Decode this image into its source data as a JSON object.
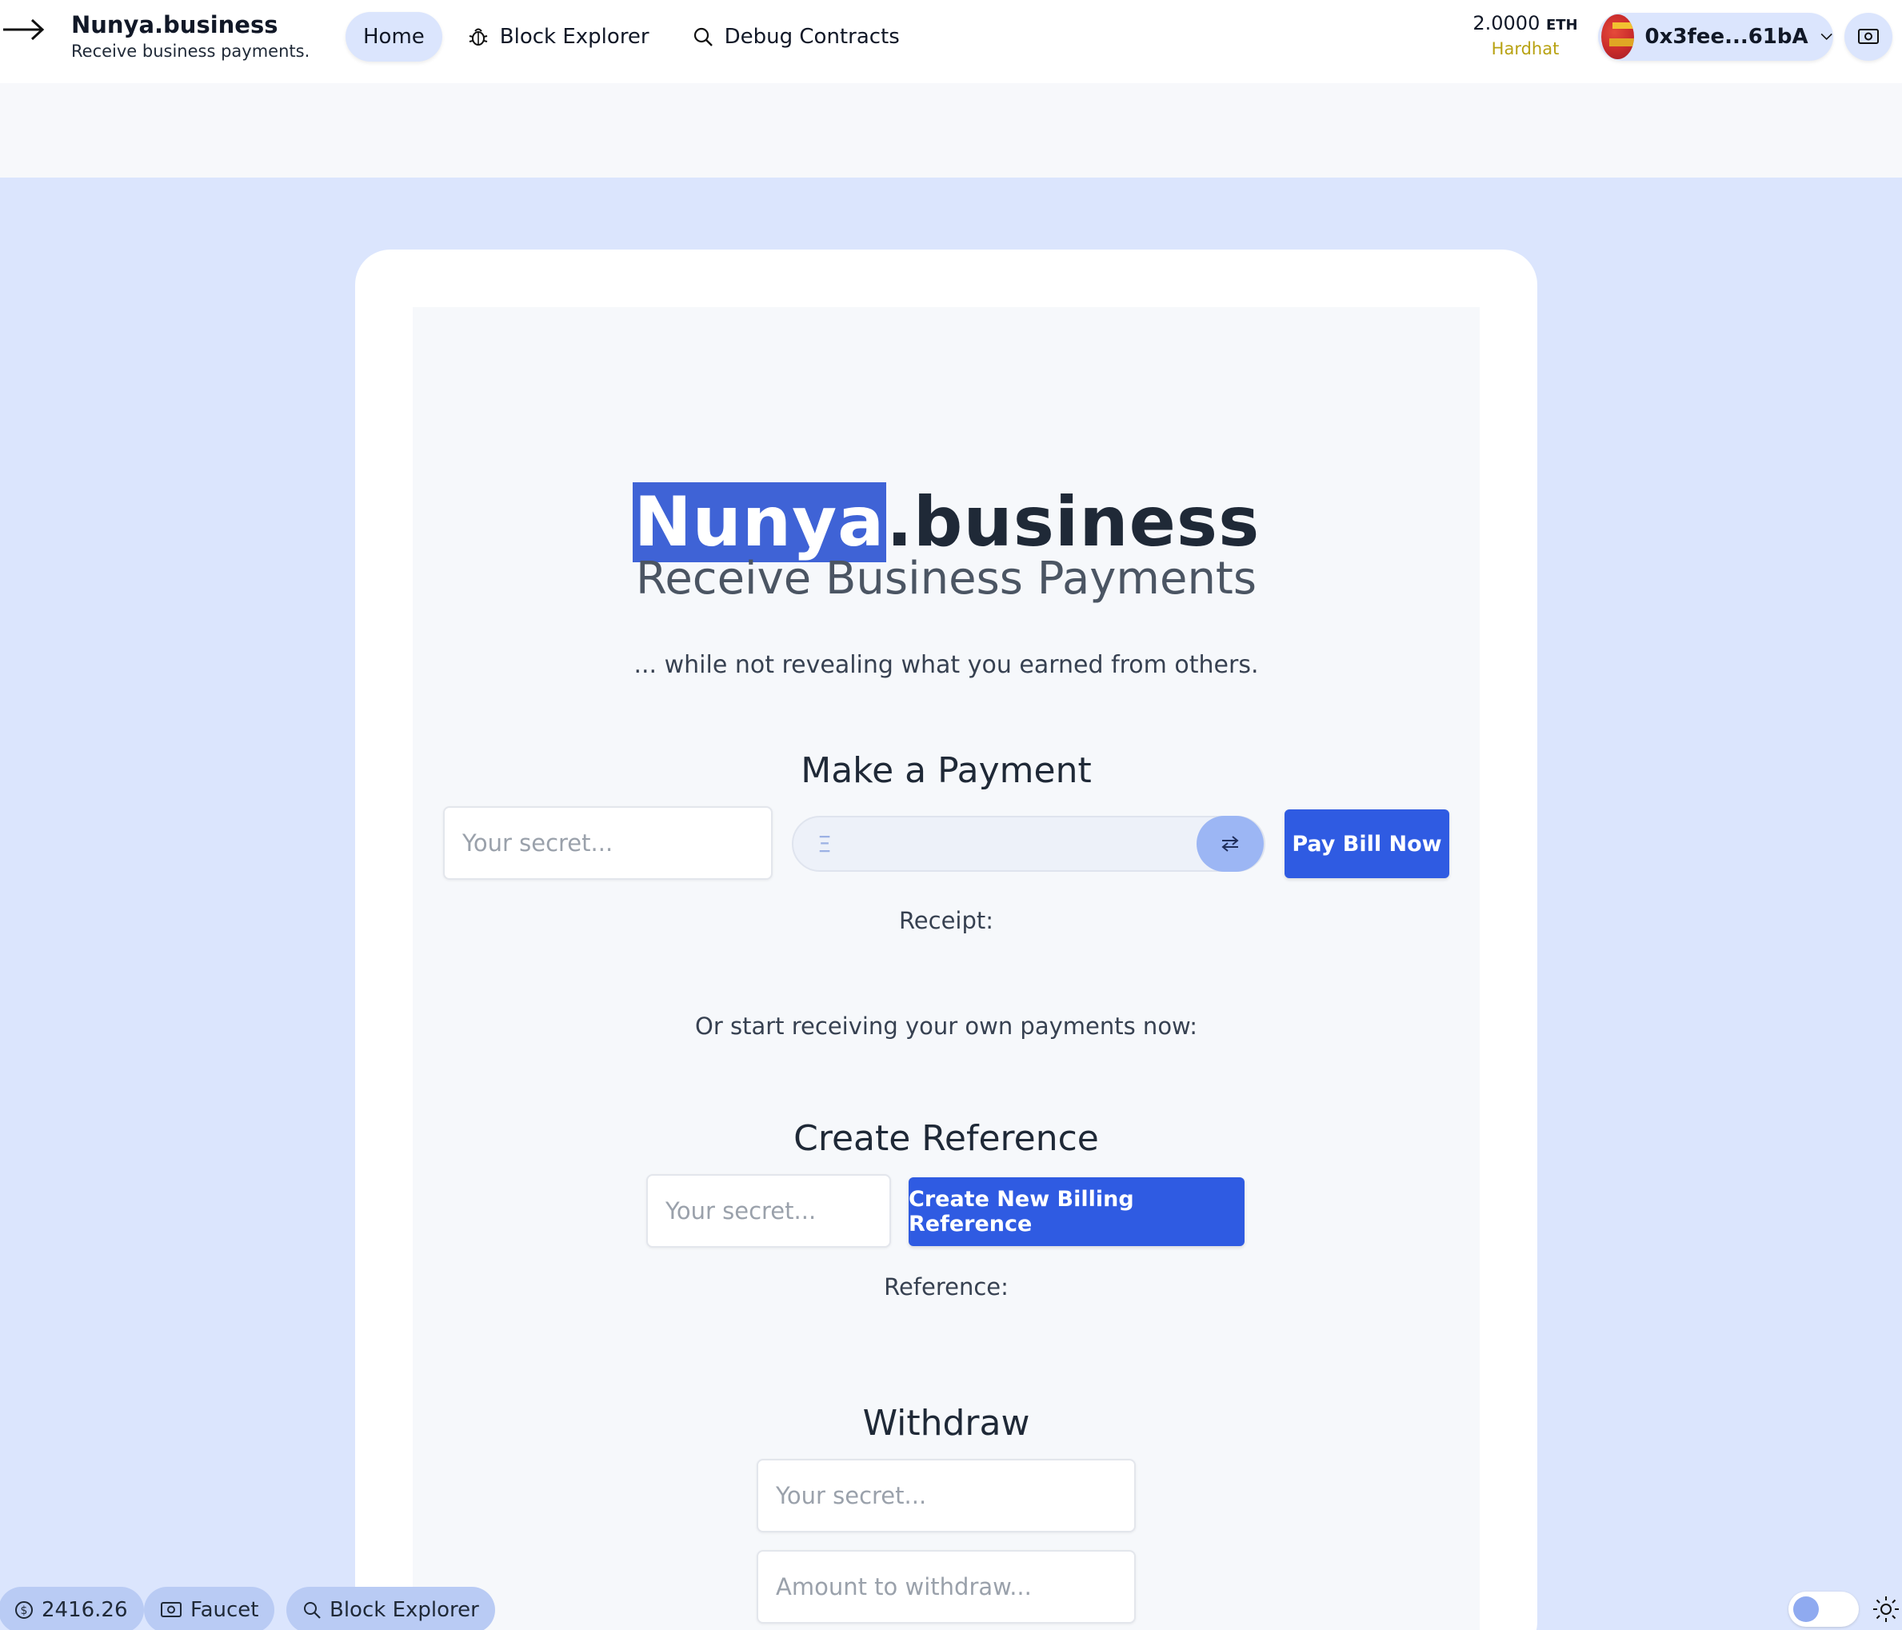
{
  "header": {
    "brand_name": "Nunya.business",
    "brand_tagline": "Receive business payments.",
    "nav": [
      {
        "label": "Home"
      },
      {
        "label": "Block Explorer"
      },
      {
        "label": "Debug Contracts"
      }
    ],
    "balance_value": "2.0000",
    "balance_unit": "ETH",
    "network": "Hardhat",
    "account_address": "0x3fee...61bA"
  },
  "hero": {
    "title_highlight": "Nunya",
    "title_rest": ".business",
    "subtitle": "Receive Business Payments",
    "note": "... while not revealing what you earned from others."
  },
  "payment": {
    "title": "Make a Payment",
    "secret_placeholder": "Your secret...",
    "eth_symbol": "Ξ",
    "pay_button": "Pay Bill Now",
    "receipt_label": "Receipt:"
  },
  "own_payments_text": "Or start receiving your own payments now:",
  "reference": {
    "title": "Create Reference",
    "secret_placeholder": "Your secret...",
    "create_button": "Create New Billing Reference",
    "reference_label": "Reference:"
  },
  "withdraw": {
    "title": "Withdraw",
    "secret_placeholder": "Your secret...",
    "amount_placeholder": "Amount to withdraw..."
  },
  "footer": {
    "price": "2416.26",
    "faucet": "Faucet",
    "block_explorer": "Block Explorer"
  },
  "colors": {
    "accent": "#2f5be2",
    "page_bg": "#dbe5fd",
    "network": "#b8a212"
  }
}
